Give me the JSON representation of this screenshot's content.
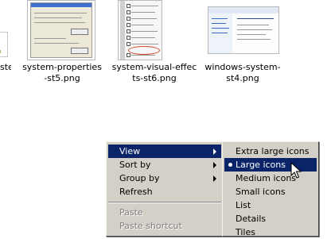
{
  "files": [
    {
      "name": "system-properties-st5.png"
    },
    {
      "name": "system-visual-effects-st6.png"
    },
    {
      "name": "windows-system-st4.png"
    }
  ],
  "partial_label": "ste",
  "context_menu": {
    "items": [
      {
        "label": "View",
        "submenu": true,
        "highlighted": true
      },
      {
        "label": "Sort by",
        "submenu": true
      },
      {
        "label": "Group by",
        "submenu": true
      },
      {
        "label": "Refresh"
      },
      {
        "label": "Paste",
        "disabled": true
      },
      {
        "label": "Paste shortcut",
        "disabled": true
      }
    ]
  },
  "view_submenu": {
    "items": [
      {
        "label": "Extra large icons"
      },
      {
        "label": "Large icons",
        "selected": true
      },
      {
        "label": "Medium icons"
      },
      {
        "label": "Small icons"
      },
      {
        "label": "List"
      },
      {
        "label": "Details"
      },
      {
        "label": "Tiles"
      }
    ]
  },
  "colors": {
    "menu_bg": "#d4d0c8",
    "highlight": "#0a246a",
    "disabled_text": "#808080"
  },
  "icons": [
    "arrow-right-icon",
    "radio-bullet-icon",
    "mouse-pointer-icon"
  ]
}
